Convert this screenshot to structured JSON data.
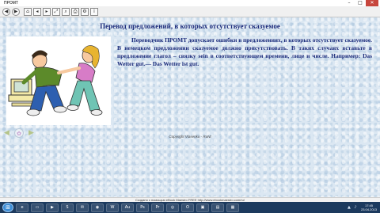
{
  "window": {
    "title": "ПРОМТ",
    "controls": [
      "–",
      "□",
      "✕"
    ]
  },
  "toolbar": {
    "buttons": [
      {
        "name": "back-button",
        "glyph": "◀"
      },
      {
        "name": "forward-button",
        "glyph": "▶"
      },
      {
        "name": "home-button",
        "glyph": "⌂"
      },
      {
        "name": "prev-page-button",
        "glyph": "◂"
      },
      {
        "name": "next-page-button",
        "glyph": "▸"
      },
      {
        "name": "fullscreen-button",
        "glyph": "⤢"
      },
      {
        "name": "search-button",
        "glyph": "⌕"
      },
      {
        "name": "print-button",
        "glyph": "⎙"
      },
      {
        "name": "options-button",
        "glyph": "⚙"
      },
      {
        "name": "info-button",
        "glyph": "i"
      }
    ]
  },
  "page": {
    "heading": "Перевод предложений, в которых отсутствует сказуемое",
    "body": "Переводчик ПРОМТ допускает ошибки в предложениях, в которых отсутствует сказуемое. В немецком предложении сказуемое должно присутствовать. В таких случаях  вставьте в предложение глагол – связку sein в соответствующем времени, лице и числе. Например: Das Wetter gut.— Das Wetter ist gut.",
    "copyright": "Copyright Vlasenko - RuNt",
    "nav": {
      "back_glyph": "◀",
      "home_glyph": "✿",
      "forward_glyph": "▶"
    }
  },
  "statusbar": {
    "text": "Создано с помощью eBook Maestro FREE http://www.ebookmaestro.com/ru/"
  },
  "taskbar": {
    "start_glyph": "⊞",
    "apps": [
      {
        "name": "ie-icon",
        "glyph": "e"
      },
      {
        "name": "folder-icon",
        "glyph": "▭"
      },
      {
        "name": "media-icon",
        "glyph": "▶"
      },
      {
        "name": "skype-icon",
        "glyph": "S"
      },
      {
        "name": "mail-icon",
        "glyph": "✉"
      },
      {
        "name": "firefox-icon",
        "glyph": "◉"
      },
      {
        "name": "word-icon",
        "glyph": "W"
      },
      {
        "name": "audition-icon",
        "glyph": "Au"
      },
      {
        "name": "photoshop-icon",
        "glyph": "Ps"
      },
      {
        "name": "premiere-icon",
        "glyph": "Pr"
      },
      {
        "name": "chrome-icon",
        "glyph": "◎"
      },
      {
        "name": "opera-icon",
        "glyph": "O"
      },
      {
        "name": "player-icon",
        "glyph": "▣"
      },
      {
        "name": "ebook-icon",
        "glyph": "▤"
      },
      {
        "name": "app-icon",
        "glyph": "▦"
      }
    ],
    "clock": {
      "time": "17:45",
      "date": "23.04.2013"
    }
  },
  "colors": {
    "heading": "#1a2a7a",
    "content_bg": "#dbe7f2",
    "taskbar": "#1c3a5e"
  }
}
